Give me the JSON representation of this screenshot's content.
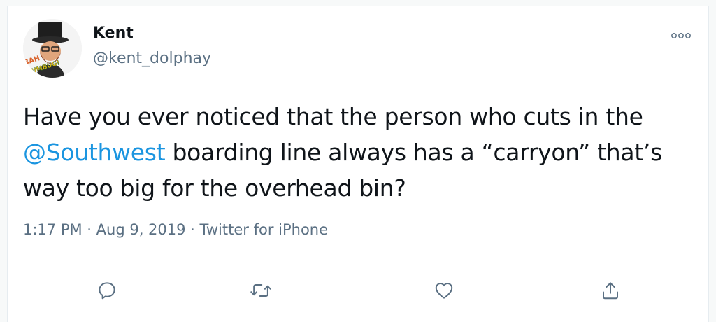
{
  "tweet": {
    "author_name": "Kent",
    "author_handle": "@kent_dolphay",
    "avatar_caption": "BAH HUMBUG!",
    "text_before_mention": "Have you ever noticed that the person who cuts in the ",
    "mention": "@Southwest",
    "text_after_mention": " boarding line always has a “carryon” that’s way too big for the overhead bin?",
    "time": "1:17 PM",
    "date": "Aug 9, 2019",
    "source": "Twitter for iPhone",
    "separator": " · "
  },
  "icons": {
    "more": "more-options-icon",
    "reply": "reply-icon",
    "retweet": "retweet-icon",
    "like": "heart-icon",
    "share": "share-icon"
  },
  "colors": {
    "link": "#1b95e0",
    "secondary_text": "#5b7083",
    "primary_text": "#0f1419",
    "border": "#e6ecf0"
  }
}
